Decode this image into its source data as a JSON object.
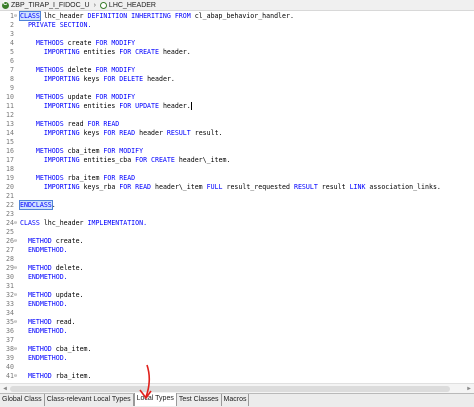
{
  "breadcrumb": {
    "items": [
      {
        "label": "ZBP_TIRAP_I_FIDOC_U",
        "icon": "class-icon"
      },
      {
        "label": "LHC_HEADER",
        "icon": "local-class-icon"
      }
    ],
    "separator": "›"
  },
  "editor": {
    "lines": [
      {
        "no": "1",
        "fold": "⊖",
        "segments": [
          {
            "t": "CLASS",
            "kw": true,
            "sel": true
          },
          {
            "t": " lhc_header "
          },
          {
            "t": "DEFINITION INHERITING FROM",
            "kw": true
          },
          {
            "t": " cl_abap_behavior_handler."
          }
        ]
      },
      {
        "no": "2",
        "segments": [
          {
            "t": "  "
          },
          {
            "t": "PRIVATE SECTION.",
            "kw": true
          }
        ]
      },
      {
        "no": "3",
        "segments": []
      },
      {
        "no": "4",
        "segments": [
          {
            "t": "    "
          },
          {
            "t": "METHODS",
            "kw": true
          },
          {
            "t": " create "
          },
          {
            "t": "FOR MODIFY",
            "kw": true
          }
        ]
      },
      {
        "no": "5",
        "segments": [
          {
            "t": "      "
          },
          {
            "t": "IMPORTING",
            "kw": true
          },
          {
            "t": " entities "
          },
          {
            "t": "FOR CREATE",
            "kw": true
          },
          {
            "t": " header."
          }
        ]
      },
      {
        "no": "6",
        "segments": []
      },
      {
        "no": "7",
        "segments": [
          {
            "t": "    "
          },
          {
            "t": "METHODS",
            "kw": true
          },
          {
            "t": " delete "
          },
          {
            "t": "FOR MODIFY",
            "kw": true
          }
        ]
      },
      {
        "no": "8",
        "segments": [
          {
            "t": "      "
          },
          {
            "t": "IMPORTING",
            "kw": true
          },
          {
            "t": " keys "
          },
          {
            "t": "FOR DELETE",
            "kw": true
          },
          {
            "t": " header."
          }
        ]
      },
      {
        "no": "9",
        "segments": []
      },
      {
        "no": "10",
        "segments": [
          {
            "t": "    "
          },
          {
            "t": "METHODS",
            "kw": true
          },
          {
            "t": " update "
          },
          {
            "t": "FOR MODIFY",
            "kw": true
          }
        ]
      },
      {
        "no": "11",
        "segments": [
          {
            "t": "      "
          },
          {
            "t": "IMPORTING",
            "kw": true
          },
          {
            "t": " entities "
          },
          {
            "t": "FOR UPDATE",
            "kw": true
          },
          {
            "t": " header."
          }
        ],
        "cursor": true
      },
      {
        "no": "12",
        "segments": []
      },
      {
        "no": "13",
        "segments": [
          {
            "t": "    "
          },
          {
            "t": "METHODS",
            "kw": true
          },
          {
            "t": " read "
          },
          {
            "t": "FOR READ",
            "kw": true
          }
        ]
      },
      {
        "no": "14",
        "segments": [
          {
            "t": "      "
          },
          {
            "t": "IMPORTING",
            "kw": true
          },
          {
            "t": " keys "
          },
          {
            "t": "FOR READ",
            "kw": true
          },
          {
            "t": " header "
          },
          {
            "t": "RESULT",
            "kw": true
          },
          {
            "t": " result."
          }
        ]
      },
      {
        "no": "15",
        "segments": []
      },
      {
        "no": "16",
        "segments": [
          {
            "t": "    "
          },
          {
            "t": "METHODS",
            "kw": true
          },
          {
            "t": " cba_item "
          },
          {
            "t": "FOR MODIFY",
            "kw": true
          }
        ]
      },
      {
        "no": "17",
        "segments": [
          {
            "t": "      "
          },
          {
            "t": "IMPORTING",
            "kw": true
          },
          {
            "t": " entities_cba "
          },
          {
            "t": "FOR CREATE",
            "kw": true
          },
          {
            "t": " header\\_item."
          }
        ]
      },
      {
        "no": "18",
        "segments": []
      },
      {
        "no": "19",
        "segments": [
          {
            "t": "    "
          },
          {
            "t": "METHODS",
            "kw": true
          },
          {
            "t": " rba_item "
          },
          {
            "t": "FOR READ",
            "kw": true
          }
        ]
      },
      {
        "no": "20",
        "segments": [
          {
            "t": "      "
          },
          {
            "t": "IMPORTING",
            "kw": true
          },
          {
            "t": " keys_rba "
          },
          {
            "t": "FOR READ",
            "kw": true
          },
          {
            "t": " header\\_item "
          },
          {
            "t": "FULL",
            "kw": true
          },
          {
            "t": " result_requested "
          },
          {
            "t": "RESULT",
            "kw": true
          },
          {
            "t": " result "
          },
          {
            "t": "LINK",
            "kw": true
          },
          {
            "t": " association_links."
          }
        ]
      },
      {
        "no": "21",
        "segments": []
      },
      {
        "no": "22",
        "segments": [
          {
            "t": "ENDCLASS",
            "kw": true,
            "sel": true
          },
          {
            "t": "."
          }
        ]
      },
      {
        "no": "23",
        "segments": []
      },
      {
        "no": "24",
        "fold": "⊖",
        "segments": [
          {
            "t": "CLASS",
            "kw": true
          },
          {
            "t": " lhc_header "
          },
          {
            "t": "IMPLEMENTATION.",
            "kw": true
          }
        ]
      },
      {
        "no": "25",
        "segments": []
      },
      {
        "no": "26",
        "fold": "⊖",
        "segments": [
          {
            "t": "  "
          },
          {
            "t": "METHOD",
            "kw": true
          },
          {
            "t": " create."
          }
        ]
      },
      {
        "no": "27",
        "segments": [
          {
            "t": "  "
          },
          {
            "t": "ENDMETHOD.",
            "kw": true
          }
        ]
      },
      {
        "no": "28",
        "segments": []
      },
      {
        "no": "29",
        "fold": "⊖",
        "segments": [
          {
            "t": "  "
          },
          {
            "t": "METHOD",
            "kw": true
          },
          {
            "t": " delete."
          }
        ]
      },
      {
        "no": "30",
        "segments": [
          {
            "t": "  "
          },
          {
            "t": "ENDMETHOD.",
            "kw": true
          }
        ]
      },
      {
        "no": "31",
        "segments": []
      },
      {
        "no": "32",
        "fold": "⊖",
        "segments": [
          {
            "t": "  "
          },
          {
            "t": "METHOD",
            "kw": true
          },
          {
            "t": " update."
          }
        ]
      },
      {
        "no": "33",
        "segments": [
          {
            "t": "  "
          },
          {
            "t": "ENDMETHOD.",
            "kw": true
          }
        ]
      },
      {
        "no": "34",
        "segments": []
      },
      {
        "no": "35",
        "fold": "⊖",
        "segments": [
          {
            "t": "  "
          },
          {
            "t": "METHOD",
            "kw": true
          },
          {
            "t": " read."
          }
        ]
      },
      {
        "no": "36",
        "segments": [
          {
            "t": "  "
          },
          {
            "t": "ENDMETHOD.",
            "kw": true
          }
        ]
      },
      {
        "no": "37",
        "segments": []
      },
      {
        "no": "38",
        "fold": "⊖",
        "segments": [
          {
            "t": "  "
          },
          {
            "t": "METHOD",
            "kw": true
          },
          {
            "t": " cba_item."
          }
        ]
      },
      {
        "no": "39",
        "segments": [
          {
            "t": "  "
          },
          {
            "t": "ENDMETHOD.",
            "kw": true
          }
        ]
      },
      {
        "no": "40",
        "segments": []
      },
      {
        "no": "41",
        "fold": "⊖",
        "segments": [
          {
            "t": "  "
          },
          {
            "t": "METHOD",
            "kw": true
          },
          {
            "t": " rba_item."
          }
        ]
      }
    ]
  },
  "bottom_tabs": [
    {
      "label": "Global Class",
      "active": false
    },
    {
      "label": "Class-relevant Local Types",
      "active": false
    },
    {
      "label": "Local Types",
      "active": true
    },
    {
      "label": "Test Classes",
      "active": false
    },
    {
      "label": "Macros",
      "active": false
    }
  ],
  "colors": {
    "keyword": "#0000ff",
    "line_number": "#7a7a7a",
    "annotation_arrow": "#e0201b"
  }
}
